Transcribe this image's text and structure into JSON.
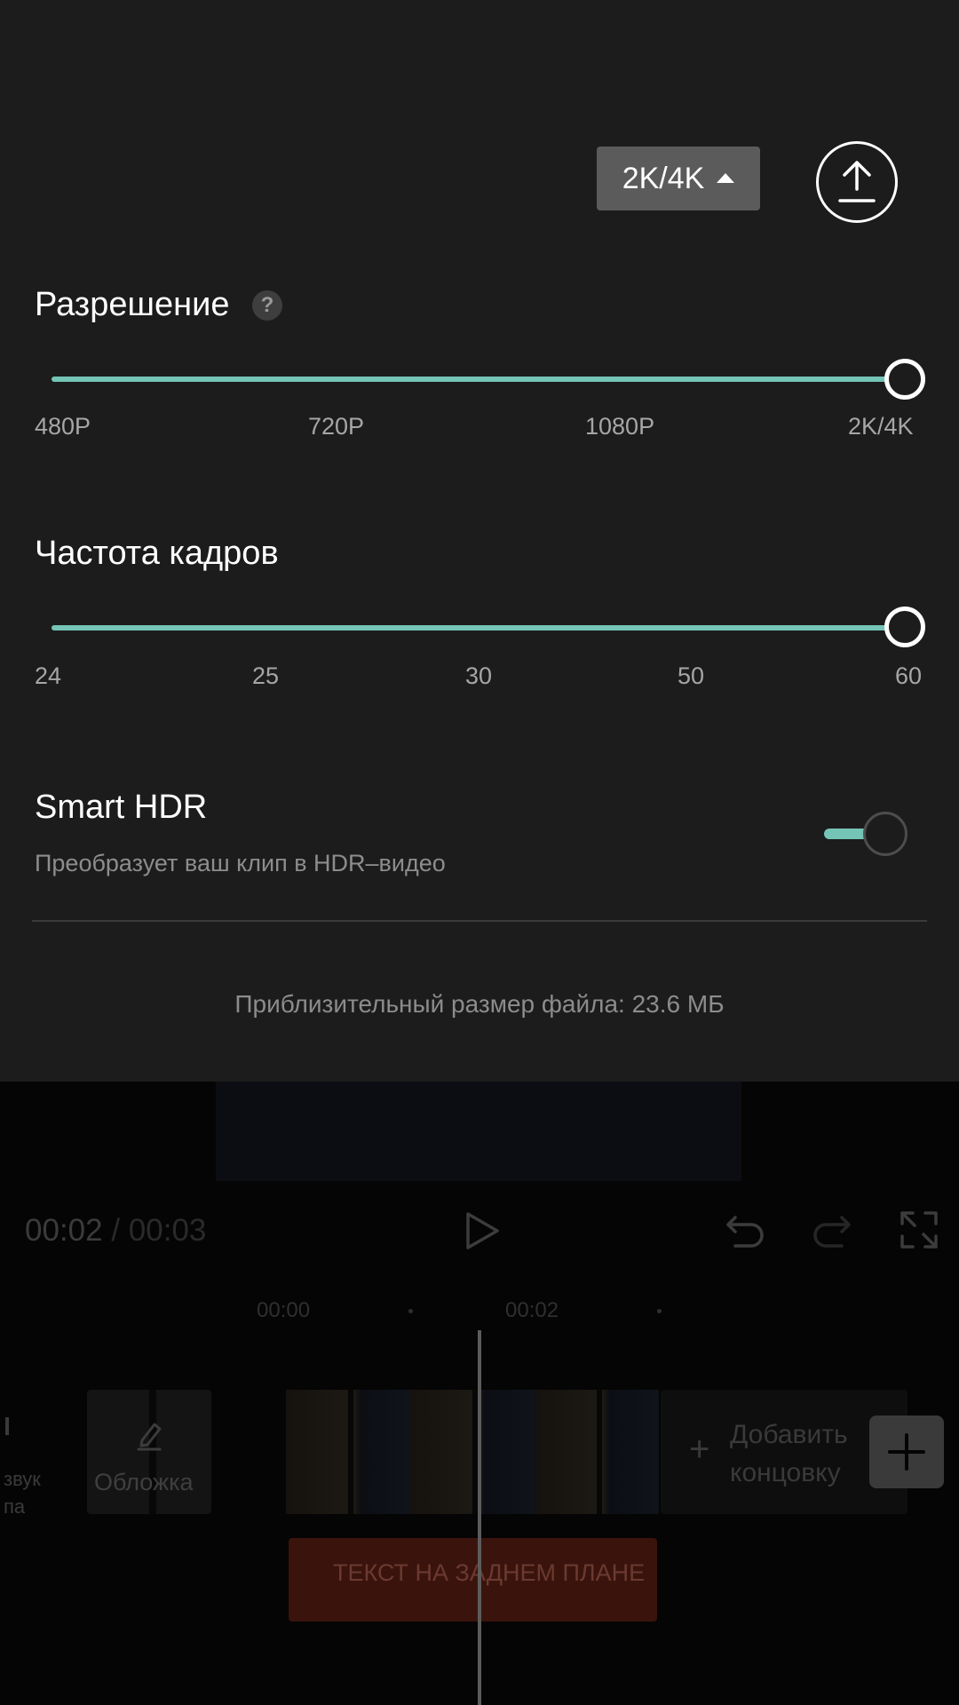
{
  "export_panel": {
    "resolution_badge": "2K/4K",
    "resolution": {
      "title": "Разрешение",
      "help": "?",
      "options": [
        "480P",
        "720P",
        "1080P",
        "2K/4K"
      ],
      "selected": "2K/4K"
    },
    "frame_rate": {
      "title": "Частота кадров",
      "options": [
        "24",
        "25",
        "30",
        "50",
        "60"
      ],
      "selected": "60"
    },
    "smart_hdr": {
      "title": "Smart HDR",
      "description": "Преобразует ваш клип в HDR–видео",
      "enabled": false
    },
    "file_size_note": "Приблизительный размер файла: 23.6 МБ",
    "accent_color": "#74c5b6"
  },
  "editor": {
    "time_current": "00:02",
    "time_separator": "/",
    "time_total": "00:03",
    "ruler": [
      "00:00",
      "00:02"
    ],
    "audio_label_line1": "звук",
    "audio_label_line2": "па",
    "cover_label": "Обложка",
    "add_ending_line1": "Добавить",
    "add_ending_line2": "концовку",
    "text_track": "ТЕКСТ НА ЗАДНЕМ ПЛАНЕ",
    "icons": [
      "upload-icon",
      "play-icon",
      "undo-icon",
      "redo-icon",
      "fullscreen-icon",
      "pencil-icon",
      "plus-icon"
    ]
  }
}
